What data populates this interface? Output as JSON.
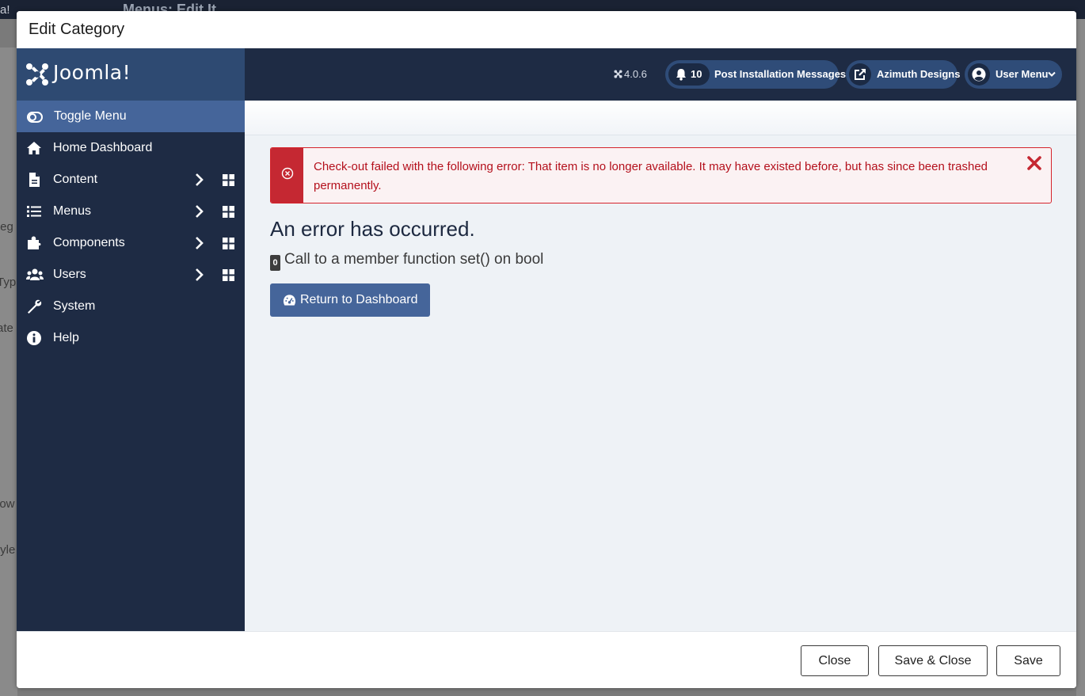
{
  "background": {
    "app_logo_fragment": "a!",
    "page_title_fragment": "Menus: Edit It",
    "left_labels": [
      "teg",
      "Typ",
      "ate",
      "low",
      "tyle"
    ]
  },
  "modal": {
    "title": "Edit Category"
  },
  "brand": {
    "name": "Joomla!"
  },
  "sidebar": {
    "toggle_label": "Toggle Menu",
    "items": [
      {
        "label": "Home Dashboard",
        "icon": "home-icon",
        "submenu": false
      },
      {
        "label": "Content",
        "icon": "file-icon",
        "submenu": true
      },
      {
        "label": "Menus",
        "icon": "list-icon",
        "submenu": true
      },
      {
        "label": "Components",
        "icon": "puzzle-icon",
        "submenu": true
      },
      {
        "label": "Users",
        "icon": "users-icon",
        "submenu": true
      },
      {
        "label": "System",
        "icon": "wrench-icon",
        "submenu": false
      },
      {
        "label": "Help",
        "icon": "info-icon",
        "submenu": false
      }
    ]
  },
  "header": {
    "version": "4.0.6",
    "notifications_count": "10",
    "post_install_label": "Post Installation Messages",
    "site_label": "Azimuth Designs",
    "user_menu_label": "User Menu"
  },
  "alert": {
    "message": "Check-out failed with the following error: That item is no longer available. It may have existed before, but has since been trashed permanently."
  },
  "error": {
    "title": "An error has occurred.",
    "code": "0",
    "message": "Call to a member function set() on bool",
    "return_button": "Return to Dashboard"
  },
  "footer": {
    "close_label": "Close",
    "save_close_label": "Save & Close",
    "save_label": "Save"
  },
  "colors": {
    "sidebar_bg": "#1e2b44",
    "accent": "#45659a",
    "danger": "#c52832"
  }
}
